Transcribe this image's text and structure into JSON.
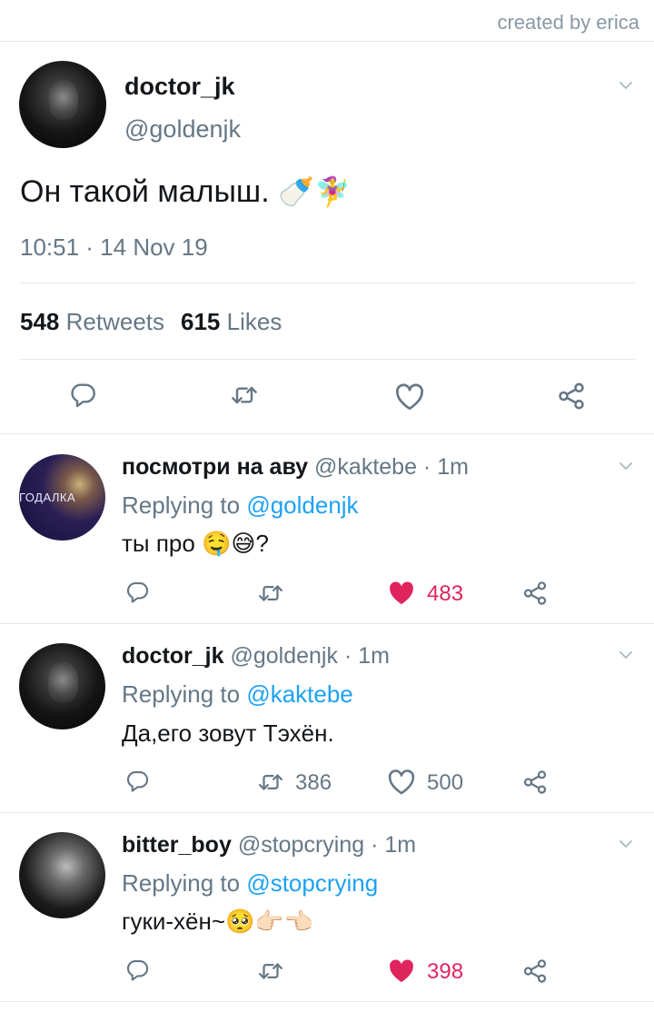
{
  "header": {
    "credit": "created by erica"
  },
  "main_tweet": {
    "display_name": "doctor_jk",
    "handle": "@goldenjk",
    "text": "Он такой малыш.",
    "emojis": "🍼🧚‍♀️",
    "timestamp": "10:51 · 14 Nov 19",
    "retweets_count": "548",
    "retweets_label": "Retweets",
    "likes_count": "615",
    "likes_label": "Likes"
  },
  "replies": [
    {
      "display_name": "посмотри на аву",
      "handle_time": "@kaktebe · 1m",
      "avatar_label": "ГОДАЛКА",
      "replying_prefix": "Replying to ",
      "replying_to": "@goldenjk",
      "text": "ты про",
      "emojis": "🤤😅",
      "text_suffix": "?",
      "retweet_count": "",
      "like_count": "483",
      "liked": true
    },
    {
      "display_name": "doctor_jk",
      "handle_time": "@goldenjk · 1m",
      "replying_prefix": "Replying to ",
      "replying_to": "@kaktebe",
      "text": "Да,его зовут Тэхён.",
      "retweet_count": "386",
      "like_count": "500",
      "liked": false
    },
    {
      "display_name": "bitter_boy",
      "handle_time": "@stopcrying · 1m",
      "replying_prefix": "Replying to ",
      "replying_to": "@stopcrying",
      "text": "гуки-хён~",
      "emojis": "🥺👉🏻👈🏻",
      "retweet_count": "",
      "like_count": "398",
      "liked": true
    }
  ],
  "colors": {
    "accent_link": "#1da1f2",
    "like_active": "#e0245e",
    "muted_text": "#657786",
    "icon_gray": "#657786",
    "divider": "#e1e8ed"
  },
  "icons": [
    "reply-icon",
    "retweet-icon",
    "like-icon",
    "share-icon",
    "chevron-down-icon"
  ]
}
